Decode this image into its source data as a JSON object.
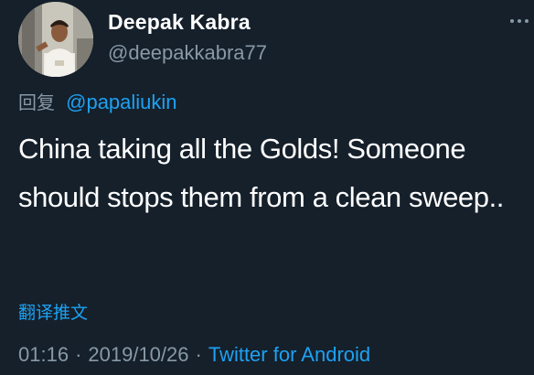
{
  "user": {
    "display_name": "Deepak Kabra",
    "handle": "@deepakkabra77"
  },
  "reply": {
    "prefix": "回复",
    "mention": "@papaliukin"
  },
  "tweet": {
    "text": "China taking all the Golds! Someone should stops them from a clean sweep.."
  },
  "translate_label": "翻译推文",
  "meta": {
    "time": "01:16",
    "separator": "·",
    "date": "2019/10/26",
    "source": "Twitter for Android"
  },
  "icons": {
    "more": "more-horizontal-icon",
    "avatar": "profile-photo"
  },
  "colors": {
    "background": "#15202b",
    "primary_text": "#ffffff",
    "secondary_text": "#8899a6",
    "accent": "#1da1f2"
  }
}
